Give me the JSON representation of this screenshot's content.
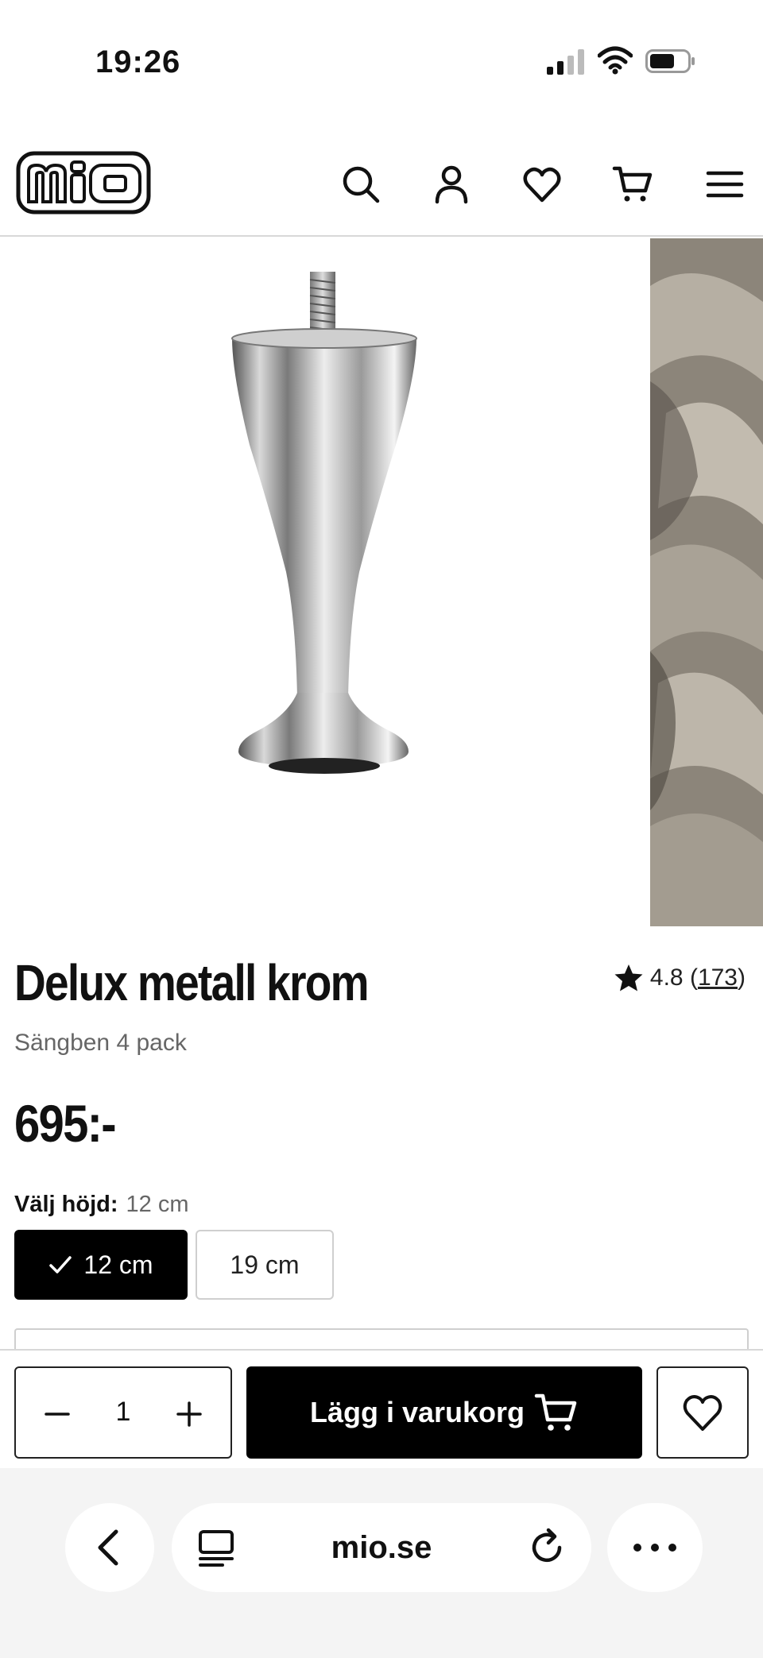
{
  "status_bar": {
    "time": "19:26"
  },
  "header": {
    "logo_text": "mio",
    "icons": [
      "search-icon",
      "user-icon",
      "heart-icon",
      "cart-icon",
      "menu-icon"
    ]
  },
  "product": {
    "title": "Delux metall krom",
    "subtitle": "Sängben 4 pack",
    "price": "695:-",
    "rating": {
      "score": "4.8",
      "count": "173"
    }
  },
  "variants": {
    "label": "Välj höjd:",
    "selected_value": "12 cm",
    "options": [
      {
        "label": "12 cm",
        "selected": true
      },
      {
        "label": "19 cm",
        "selected": false
      }
    ]
  },
  "buy_bar": {
    "quantity": "1",
    "add_to_cart_label": "Lägg i varukorg"
  },
  "browser": {
    "host": "mio.se"
  }
}
